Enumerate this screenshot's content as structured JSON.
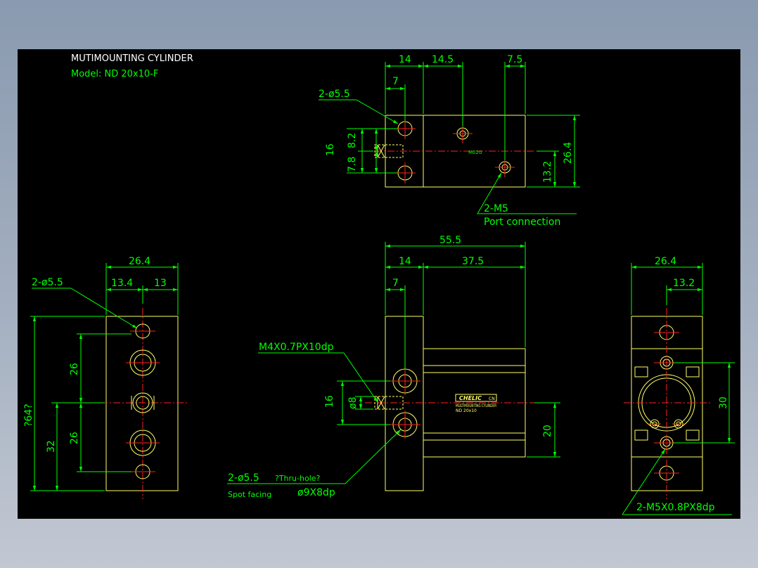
{
  "title_block": {
    "title": "MUTIMOUNTING CYLINDER",
    "model": "Model:  ND  20x10-F"
  },
  "colors": {
    "background": "#000000",
    "dimension": "#00ff00",
    "outline": "#ffff66",
    "centerline": "#ff2020",
    "title_text": "#ffffff"
  },
  "top_view": {
    "dims_top": [
      "14",
      "14.5",
      "7.5",
      "7"
    ],
    "hole_note": "2-ø5.5",
    "dims_left": [
      "16",
      "7.8",
      "8.2"
    ],
    "dims_right": [
      "26.4",
      "13.2"
    ],
    "part_mark": "M020",
    "port_note": "2-M5",
    "port_desc": "Port connection"
  },
  "left_view": {
    "dims_top": [
      "26.4",
      "13.4",
      "13"
    ],
    "hole_note": "2-ø5.5",
    "dims_left": [
      "?64?",
      "26",
      "32",
      "26"
    ]
  },
  "front_view": {
    "dims_top": [
      "55.5",
      "14",
      "37.5",
      "7"
    ],
    "thread_note": "M4X0.7PX10dp",
    "dims_left": [
      "16",
      "ø8"
    ],
    "dims_right": [
      "20"
    ],
    "logo": "CHELIC",
    "logo_sub": "CN",
    "label_line1": "MULTIMOUNTING CYLINDER",
    "label_line2": "ND 20x10",
    "hole_note": "2-ø5.5",
    "thru_note": "?Thru-hole?",
    "spot_label": "Spot facing",
    "spot_value": "ø9X8dp"
  },
  "right_view": {
    "dims_top": [
      "26.4",
      "13.2"
    ],
    "dims_right": [
      "30"
    ],
    "thread_note": "2-M5X0.8PX8dp"
  }
}
